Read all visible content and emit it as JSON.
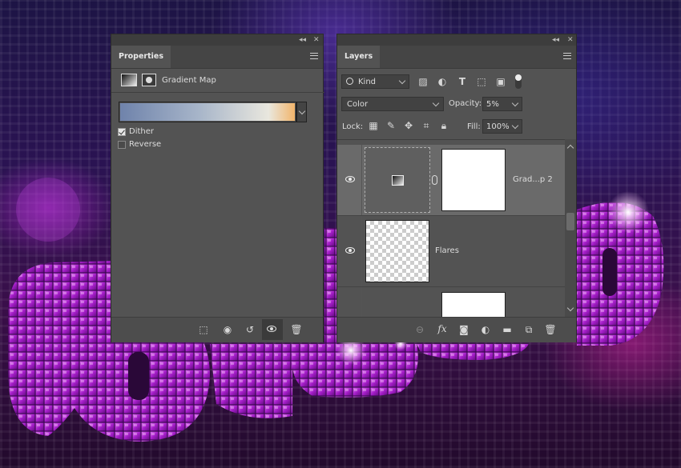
{
  "properties": {
    "tab_label": "Properties",
    "adjustment_name": "Gradient Map",
    "gradient_colors": [
      "#6f83ab",
      "#a7b5c9",
      "#e9e7de",
      "#f2b56b"
    ],
    "dither_label": "Dither",
    "dither_checked": true,
    "reverse_label": "Reverse",
    "reverse_checked": false
  },
  "layers": {
    "tab_label": "Layers",
    "filter_kind": "Kind",
    "blend_mode": "Color",
    "opacity_label": "Opacity:",
    "opacity_value": "5%",
    "lock_label": "Lock:",
    "fill_label": "Fill:",
    "fill_value": "100%",
    "items": [
      {
        "name": "Grad...p 2"
      },
      {
        "name": "Flares"
      }
    ]
  },
  "window_controls": {
    "collapse": "◂◂",
    "close": "✕"
  },
  "colors": {
    "panel": "#535353",
    "selected_layer": "#6a6a6a",
    "tab_bar": "#454545"
  }
}
